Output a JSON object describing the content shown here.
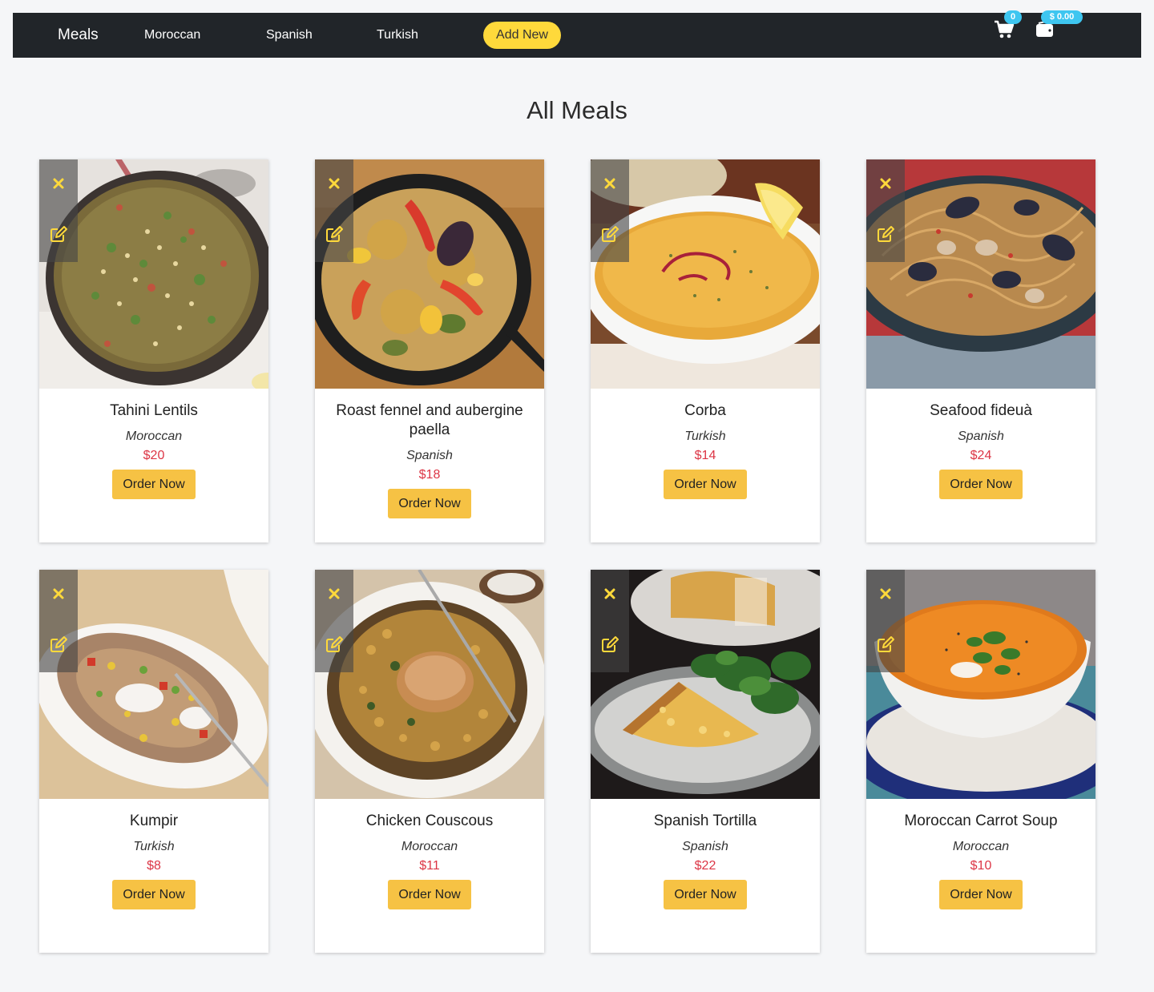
{
  "navbar": {
    "brand": "Meals",
    "links": [
      "Moroccan",
      "Spanish",
      "Turkish"
    ],
    "add_new": "Add New",
    "cart_icon": "cart-icon",
    "cart_count": "0",
    "wallet_icon": "wallet-icon",
    "wallet_amount": "$ 0.00"
  },
  "main": {
    "title": "All Meals",
    "order_label": "Order Now",
    "delete_icon": "close-icon",
    "edit_icon": "edit-icon",
    "accent_colors": {
      "control": "#ffd93b",
      "price": "#dc3545",
      "button": "#f6c244",
      "badge": "#3ec6f0"
    },
    "meals": [
      {
        "name": "Tahini Lentils",
        "category": "Moroccan",
        "price": "$20"
      },
      {
        "name": "Roast fennel and aubergine paella",
        "category": "Spanish",
        "price": "$18"
      },
      {
        "name": "Corba",
        "category": "Turkish",
        "price": "$14"
      },
      {
        "name": "Seafood fideuà",
        "category": "Spanish",
        "price": "$24"
      },
      {
        "name": "Kumpir",
        "category": "Turkish",
        "price": "$8"
      },
      {
        "name": "Chicken Couscous",
        "category": "Moroccan",
        "price": "$11"
      },
      {
        "name": "Spanish Tortilla",
        "category": "Spanish",
        "price": "$22"
      },
      {
        "name": "Moroccan Carrot Soup",
        "category": "Moroccan",
        "price": "$10"
      }
    ]
  }
}
